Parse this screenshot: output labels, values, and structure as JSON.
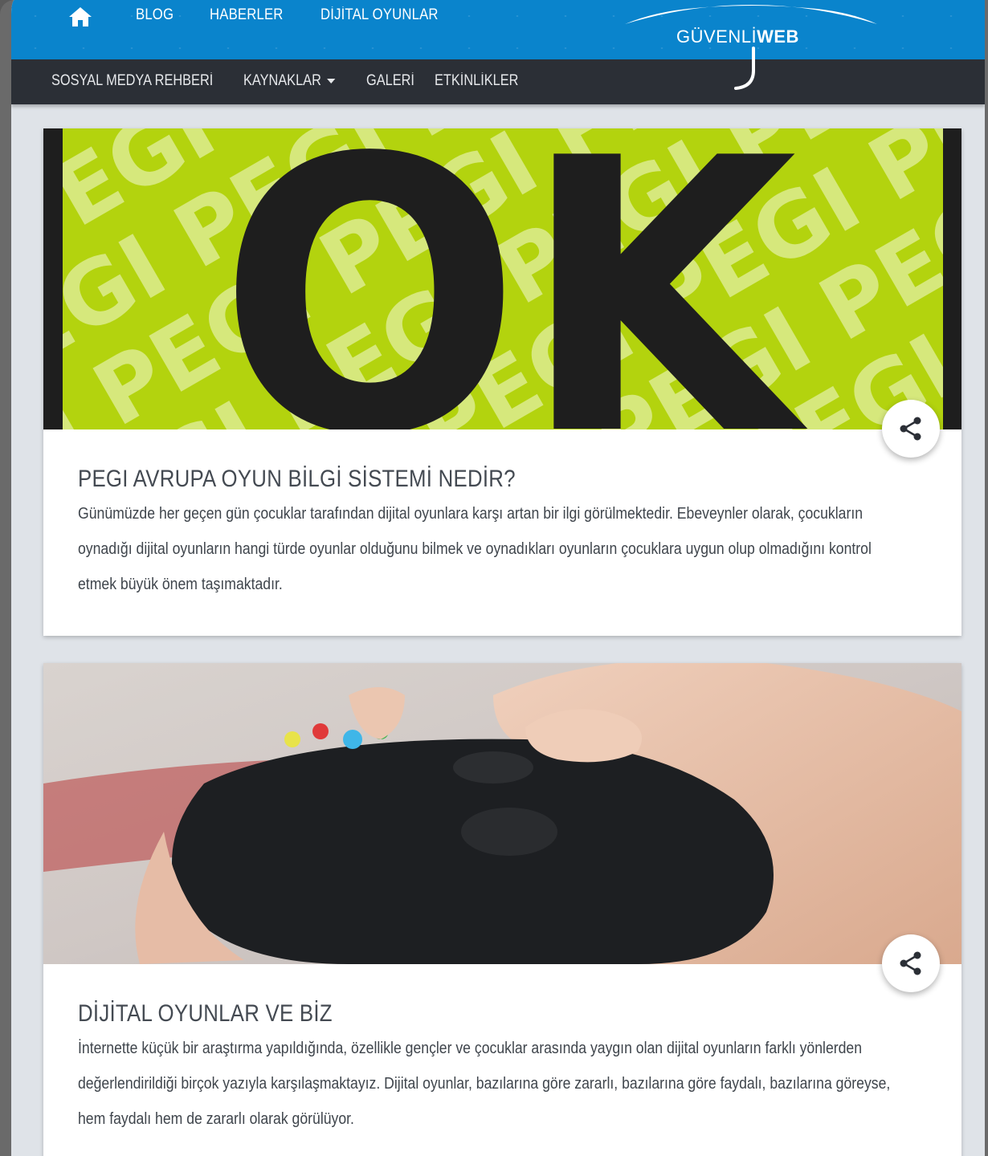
{
  "header": {
    "top_links": [
      "BLOG",
      "HABERLER",
      "DİJİTAL OYUNLAR"
    ],
    "logo": {
      "part1": "GÜVENLİ",
      "part2": "WEB"
    },
    "nav_links": [
      "SOSYAL MEDYA REHBERİ",
      "KAYNAKLAR",
      "GALERİ",
      "ETKİNLİKLER"
    ],
    "colors": {
      "top_bar": "#0a84cc",
      "nav_bar": "#2b2f36"
    }
  },
  "cards": [
    {
      "image": "pegi-ok-label",
      "image_text": "OK",
      "image_pattern_word": "PEGI",
      "title": "PEGI AVRUPA OYUN BİLGİ SİSTEMİ NEDİR?",
      "text": "Günümüzde her geçen gün çocuklar tarafından dijital oyunlara karşı artan bir ilgi görülmektedir. Ebeveynler olarak, çocukların oynadığı dijital oyunların hangi türde oyunlar olduğunu bilmek ve oynadıkları oyunların çocuklara uygun olup olmadığını kontrol etmek büyük önem taşımaktadır."
    },
    {
      "image": "hands-holding-game-controller",
      "title": "DİJİTAL OYUNLAR VE BİZ",
      "text": "İnternette küçük bir araştırma yapıldığında, özellikle gençler ve çocuklar arasında yaygın olan dijital oyunların farklı yönlerden değerlendirildiği birçok yazıyla karşılaşmaktayız. Dijital oyunlar, bazılarına göre zararlı, bazılarına göre faydalı, bazılarına göreyse, hem faydalı hem de zararlı olarak görülüyor."
    }
  ]
}
